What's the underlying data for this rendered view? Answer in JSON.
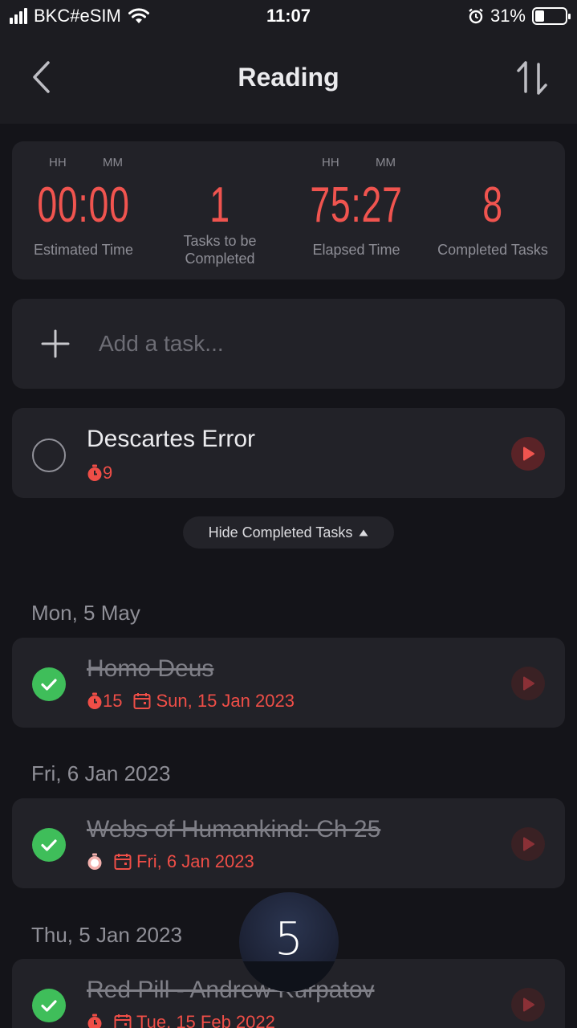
{
  "status": {
    "carrier": "BKC#eSIM",
    "time": "11:07",
    "battery": "31%",
    "battery_level": 0.31
  },
  "header": {
    "title": "Reading",
    "back_icon": "chevron-left-icon",
    "sort_icon": "sort-icon"
  },
  "stats": {
    "estimated": {
      "value": "00:00",
      "label": "Estimated Time",
      "unit_h": "HH",
      "unit_m": "MM"
    },
    "tasks_to_complete": {
      "value": "1",
      "label_line1": "Tasks to be",
      "label_line2": "Completed"
    },
    "elapsed": {
      "value": "75:27",
      "label": "Elapsed Time",
      "unit_h": "HH",
      "unit_m": "MM"
    },
    "completed": {
      "value": "8",
      "label": "Completed Tasks"
    }
  },
  "add_task": {
    "placeholder": "Add a task..."
  },
  "active_task": {
    "title": "Descartes Error",
    "pomodoros": "9"
  },
  "toggle_label": "Hide Completed Tasks",
  "completed_groups": [
    {
      "date": "Mon, 5 May",
      "title": "Homo Deus",
      "pomodoros": "15",
      "due": "Sun, 15 Jan 2023"
    },
    {
      "date": "Fri, 6 Jan 2023",
      "title": "Webs of Humankind: Ch 25",
      "pomodoros": "",
      "due": "Fri, 6 Jan 2023"
    },
    {
      "date": "Thu, 5 Jan 2023",
      "title": "Red Pill - Andrew Kurpatov",
      "pomodoros": "",
      "due": "Tue, 15 Feb 2022"
    }
  ],
  "floating_timer": "5",
  "colors": {
    "accent": "#f0544f",
    "check": "#3fbe5a",
    "background": "#141419",
    "card": "#222228"
  }
}
